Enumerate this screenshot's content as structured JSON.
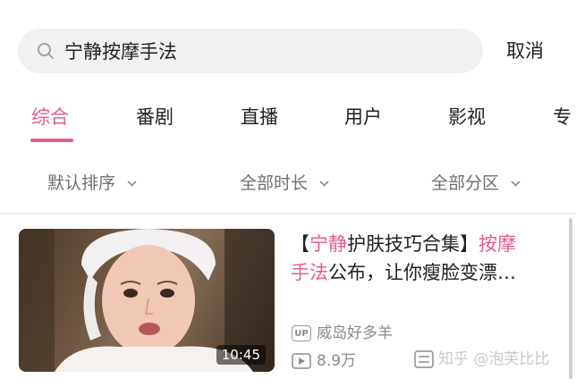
{
  "search": {
    "value": "宁静按摩手法",
    "placeholder": "",
    "cancel_label": "取消"
  },
  "tabs": [
    {
      "label": "综合",
      "active": true
    },
    {
      "label": "番剧",
      "active": false
    },
    {
      "label": "直播",
      "active": false
    },
    {
      "label": "用户",
      "active": false
    },
    {
      "label": "影视",
      "active": false
    },
    {
      "label": "专",
      "active": false
    }
  ],
  "filters": [
    {
      "label": "默认排序"
    },
    {
      "label": "全部时长"
    },
    {
      "label": "全部分区"
    }
  ],
  "results": [
    {
      "title_line1_open": "【",
      "title_line1_hl": "宁静",
      "title_line1_mid": "护肤技巧合集】",
      "title_line1_hl2": "按摩",
      "title_line2_hl": "手法",
      "title_line2_rest": "公布，让你瘦脸变漂…",
      "duration": "10:45",
      "uploader_badge": "UP",
      "uploader": "威岛好多羊",
      "views": "8.9万"
    }
  ],
  "watermark": "知乎 @泡芙比比",
  "colors": {
    "accent": "#e35c8d",
    "search_bg": "#f1f1f3",
    "muted_text": "#8a8a8a"
  },
  "icons": {
    "search": "search-icon",
    "chevron": "chevron-down-icon",
    "play": "play-icon",
    "more": "more-icon"
  }
}
